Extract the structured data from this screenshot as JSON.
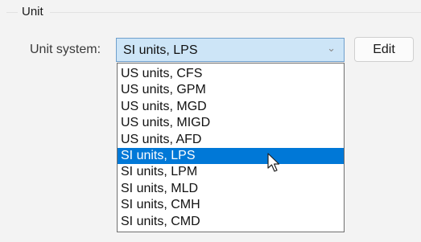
{
  "group": {
    "title": "Unit"
  },
  "unit_system": {
    "label": "Unit system:",
    "selected_value": "SI units, LPS",
    "options": [
      "US units, CFS",
      "US units, GPM",
      "US units, MGD",
      "US units, MIGD",
      "US units, AFD",
      "SI units, LPS",
      "SI units, LPM",
      "SI units, MLD",
      "SI units, CMH",
      "SI units, CMD"
    ],
    "highlighted_index": 5,
    "arrow_icon": "chevron-down-icon"
  },
  "edit_button": {
    "label": "Edit"
  },
  "colors": {
    "selection": "#0078d7",
    "combo_focus": "#cde5f7",
    "panel_background": "#f3f3f3"
  },
  "cursor_icon": "mouse-pointer-icon"
}
